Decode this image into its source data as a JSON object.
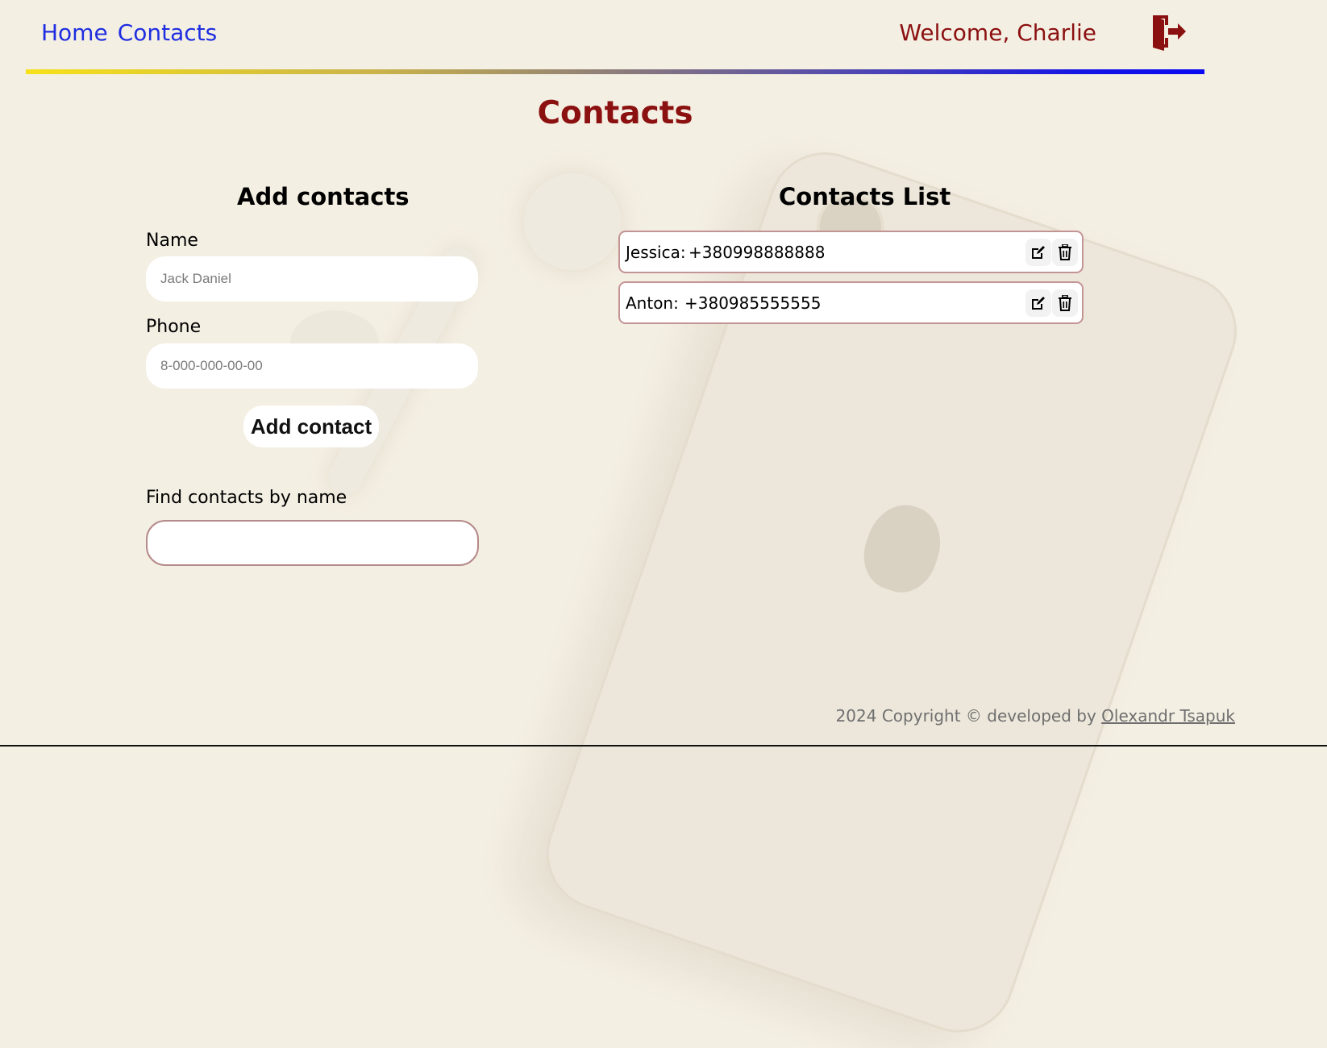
{
  "nav": {
    "home": "Home",
    "contacts": "Contacts"
  },
  "header": {
    "welcome": "Welcome, Charlie",
    "logout_icon": "logout-door-icon"
  },
  "page": {
    "title": "Contacts"
  },
  "add_form": {
    "heading": "Add contacts",
    "name_label": "Name",
    "name_placeholder": "Jack Daniel",
    "phone_label": "Phone",
    "phone_placeholder": "8-000-000-00-00",
    "submit_label": "Add contact"
  },
  "filter": {
    "label": "Find contacts by name",
    "value": ""
  },
  "contacts_list": {
    "heading": "Contacts List",
    "items": [
      {
        "name": "Jessica:",
        "phone": "+380998888888"
      },
      {
        "name": "Anton:",
        "phone": "+380985555555"
      }
    ]
  },
  "footer": {
    "text": "2024 Copyright © developed by",
    "author": "Olexandr Tsapuk"
  },
  "colors": {
    "accent": "#8b1010",
    "nav_link": "#1f2ee0",
    "background": "#f4efe3"
  }
}
